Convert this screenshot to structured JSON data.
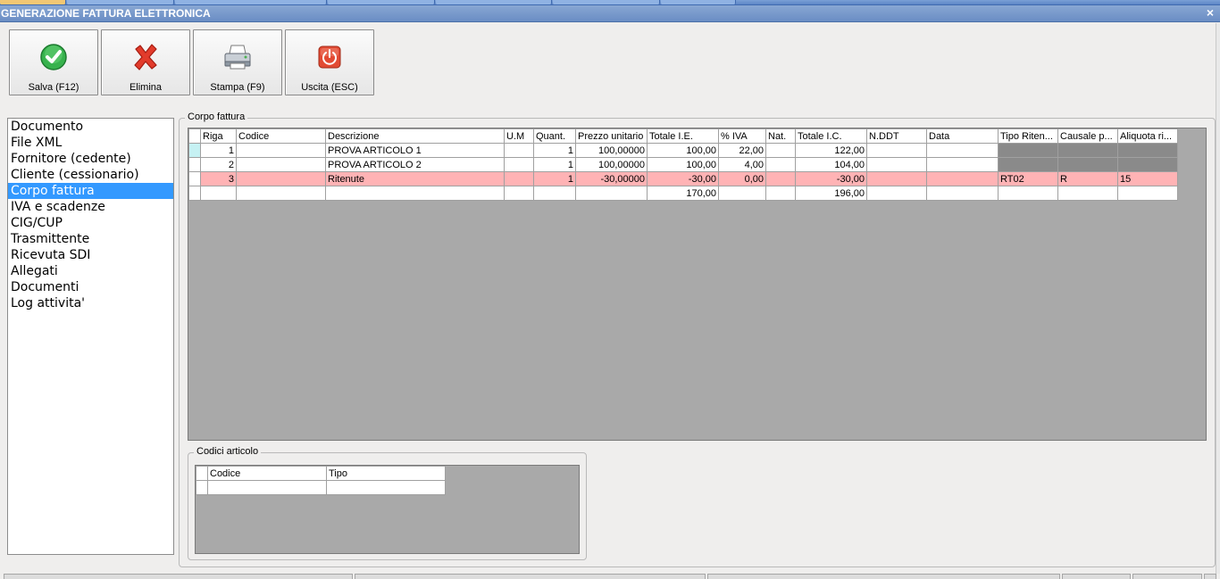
{
  "window": {
    "title": "GENERAZIONE FATTURA ELETTRONICA",
    "close_glyph": "×"
  },
  "toolbar": {
    "save": {
      "label": "Salva (F12)",
      "icon": "check-icon"
    },
    "delete": {
      "label": "Elimina",
      "icon": "red-x-icon"
    },
    "print": {
      "label": "Stampa (F9)",
      "icon": "printer-icon"
    },
    "exit": {
      "label": "Uscita (ESC)",
      "icon": "power-icon"
    }
  },
  "nav": {
    "selected": "Corpo fattura",
    "items": [
      "Documento",
      "File XML",
      "Fornitore (cedente)",
      "Cliente (cessionario)",
      "Corpo fattura",
      "IVA e scadenze",
      "CIG/CUP",
      "Trasmittente",
      "Ricevuta SDI",
      "Allegati",
      "Documenti",
      "Log attivita'"
    ]
  },
  "corpo": {
    "title": "Corpo fattura",
    "columns": [
      "Riga",
      "Codice",
      "Descrizione",
      "U.M",
      "Quant.",
      "Prezzo unitario",
      "Totale I.E.",
      "% IVA",
      "Nat.",
      "Totale I.C.",
      "N.DDT",
      "Data",
      "Tipo Riten...",
      "Causale p...",
      "Aliquota ri..."
    ],
    "rows": [
      [
        "1",
        "",
        "PROVA ARTICOLO 1",
        "",
        "1",
        "100,00000",
        "100,00",
        "22,00",
        "",
        "122,00",
        "",
        "",
        "",
        "",
        ""
      ],
      [
        "2",
        "",
        "PROVA ARTICOLO 2",
        "",
        "1",
        "100,00000",
        "100,00",
        "4,00",
        "",
        "104,00",
        "",
        "",
        "",
        "",
        ""
      ],
      [
        "3",
        "",
        "Ritenute",
        "",
        "1",
        "-30,00000",
        "-30,00",
        "0,00",
        "",
        "-30,00",
        "",
        "",
        "RT02",
        "R",
        "15"
      ],
      [
        "",
        "",
        "",
        "",
        "",
        "",
        "170,00",
        "",
        "",
        "196,00",
        "",
        "",
        "",
        "",
        ""
      ]
    ]
  },
  "codici": {
    "title": "Codici articolo",
    "columns": [
      "Codice",
      "Tipo"
    ],
    "rows": [
      [
        "",
        ""
      ]
    ]
  },
  "colors": {
    "selected_nav": "#3399ff",
    "ritenute_row": "#ffb3b5",
    "grid_background": "#a9a9a9",
    "titlebar": "#6a8dc4"
  }
}
